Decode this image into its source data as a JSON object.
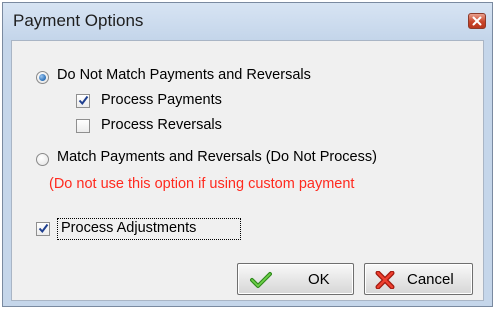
{
  "window": {
    "title": "Payment Options"
  },
  "options": {
    "do_not_match_label": "Do Not Match Payments and Reversals",
    "process_payments_label": "Process Payments",
    "process_reversals_label": "Process Reversals",
    "match_label": "Match Payments and Reversals (Do Not Process)",
    "warning_text": "(Do not use this option if using custom payment",
    "process_adjustments_label": "Process Adjustments"
  },
  "state": {
    "do_not_match_selected": true,
    "match_selected": false,
    "process_payments_checked": true,
    "process_reversals_checked": false,
    "process_adjustments_checked": true
  },
  "buttons": {
    "ok_label": "OK",
    "cancel_label": "Cancel"
  },
  "icons": {
    "close": "close-icon",
    "ok": "green-checkmark-icon",
    "cancel": "red-x-icon"
  },
  "colors": {
    "warning": "#ff2a1f",
    "accent": "#2a6fb8"
  }
}
